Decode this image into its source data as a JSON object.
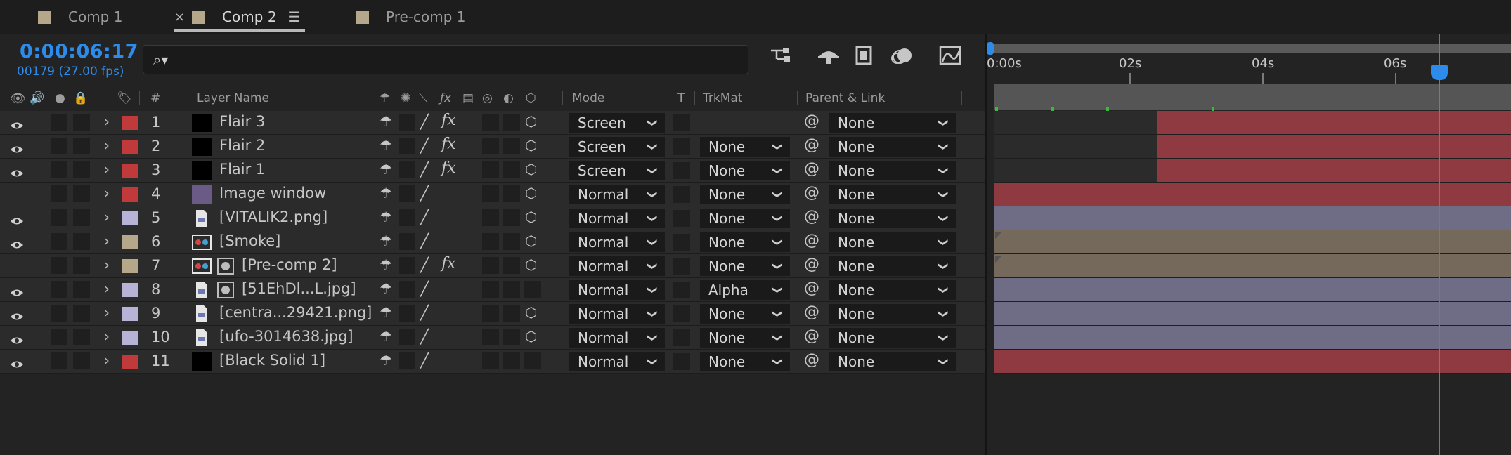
{
  "tabs": [
    {
      "label": "Comp 1"
    },
    {
      "label": "Comp 2",
      "close": "×",
      "menu": "☰"
    },
    {
      "label": "Pre-comp 1"
    }
  ],
  "controls": {
    "timecode": "0:00:06:17",
    "frames": "00179 (27.00 fps)",
    "search_icon": "⌕▾"
  },
  "header": {
    "hash": "#",
    "layer_name": "Layer Name",
    "mode": "Mode",
    "t": "T",
    "trkmat": "TrkMat",
    "parent": "Parent & Link"
  },
  "timeline": {
    "ticks": [
      "0:00s",
      "02s",
      "04s",
      "06s"
    ]
  },
  "layers": [
    {
      "num": "1",
      "name": "Flair 3",
      "label_color": "#c0393b",
      "thumb": "solid-black",
      "visible": true,
      "fx": true,
      "cube": true,
      "mode": "Screen",
      "trkmat": "",
      "parent": "None",
      "bar_color": "#8e3a40",
      "bar_start_pct": 31.5
    },
    {
      "num": "2",
      "name": "Flair 2",
      "label_color": "#c0393b",
      "thumb": "solid-black",
      "visible": true,
      "fx": true,
      "cube": true,
      "mode": "Screen",
      "trkmat": "None",
      "parent": "None",
      "bar_color": "#8e3a40",
      "bar_start_pct": 31.5
    },
    {
      "num": "3",
      "name": "Flair 1",
      "label_color": "#c0393b",
      "thumb": "solid-black",
      "visible": true,
      "fx": true,
      "cube": true,
      "mode": "Screen",
      "trkmat": "None",
      "parent": "None",
      "bar_color": "#8e3a40",
      "bar_start_pct": 31.5
    },
    {
      "num": "4",
      "name": "Image window",
      "label_color": "#c0393b",
      "thumb": "solid-purple",
      "visible": false,
      "fx": false,
      "cube": true,
      "mode": "Normal",
      "trkmat": "None",
      "parent": "None",
      "bar_color": "#8e3a40",
      "bar_start_pct": 0
    },
    {
      "num": "5",
      "name": "[VITALIK2.png]",
      "label_color": "#b7b3d6",
      "thumb": "file",
      "visible": true,
      "fx": false,
      "cube": true,
      "mode": "Normal",
      "trkmat": "None",
      "parent": "None",
      "bar_color": "#6f6d86",
      "bar_start_pct": 0
    },
    {
      "num": "6",
      "name": "[Smoke]",
      "label_color": "#b5a78a",
      "thumb": "comp",
      "visible": true,
      "fx": false,
      "cube": true,
      "mode": "Normal",
      "trkmat": "None",
      "parent": "None",
      "bar_color": "#74695a",
      "bar_start_pct": 0
    },
    {
      "num": "7",
      "name": "[Pre-comp 2]",
      "label_color": "#b5a78a",
      "thumb": "comp",
      "visible": false,
      "fx": true,
      "cube": true,
      "mode": "Normal",
      "trkmat": "None",
      "parent": "None",
      "bar_color": "#74695a",
      "bar_start_pct": 0
    },
    {
      "num": "8",
      "name": "[51EhDl...L.jpg]",
      "label_color": "#b7b3d6",
      "thumb": "file",
      "visible": true,
      "fx": false,
      "cube": false,
      "mode": "Normal",
      "trkmat": "Alpha",
      "parent": "None",
      "bar_color": "#6f6d86",
      "bar_start_pct": 0
    },
    {
      "num": "9",
      "name": "[centra...29421.png]",
      "label_color": "#b7b3d6",
      "thumb": "file",
      "visible": true,
      "fx": false,
      "cube": true,
      "mode": "Normal",
      "trkmat": "None",
      "parent": "None",
      "bar_color": "#6f6d86",
      "bar_start_pct": 0
    },
    {
      "num": "10",
      "name": "[ufo-3014638.jpg]",
      "label_color": "#b7b3d6",
      "thumb": "file",
      "visible": true,
      "fx": false,
      "cube": true,
      "mode": "Normal",
      "trkmat": "None",
      "parent": "None",
      "bar_color": "#6f6d86",
      "bar_start_pct": 0
    },
    {
      "num": "11",
      "name": "[Black Solid 1]",
      "label_color": "#c0393b",
      "thumb": "solid-black",
      "visible": true,
      "fx": false,
      "cube": false,
      "mode": "Normal",
      "trkmat": "None",
      "parent": "None",
      "bar_color": "#8e3a40",
      "bar_start_pct": 0
    }
  ]
}
